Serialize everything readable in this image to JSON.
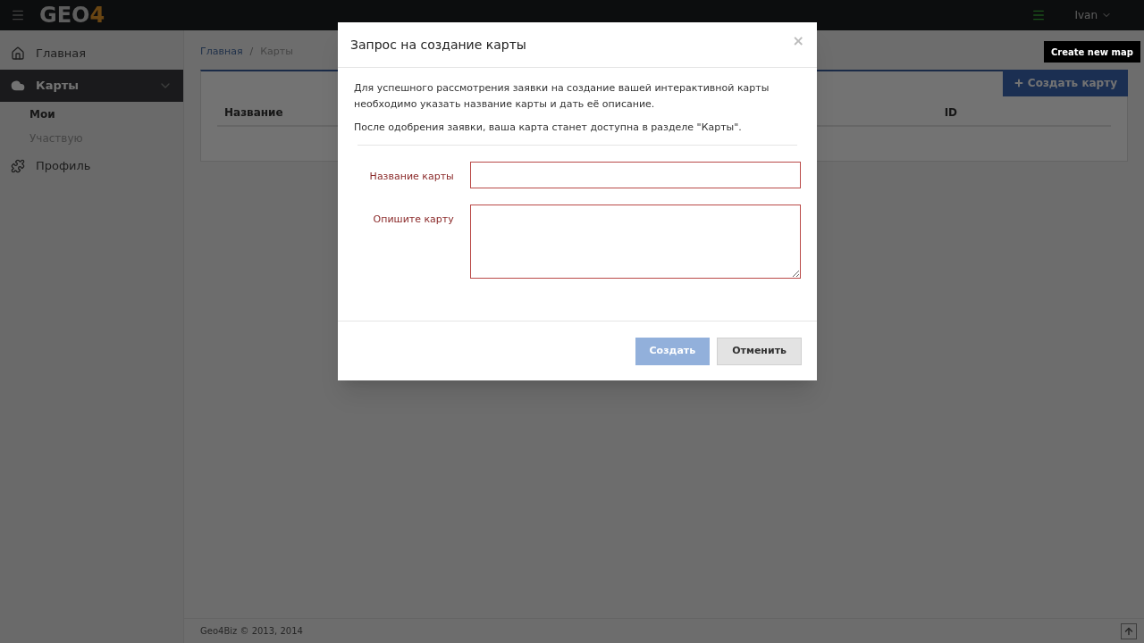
{
  "topbar": {
    "logo_main": "GEO",
    "logo_accent": "4",
    "user": "Ivan"
  },
  "sidebar": {
    "items": [
      {
        "label": "Главная",
        "selected": false,
        "expanded": false
      },
      {
        "label": "Карты",
        "selected": true,
        "expanded": true,
        "children": [
          {
            "label": "Мои",
            "selected": true
          },
          {
            "label": "Участвую",
            "selected": false
          }
        ]
      },
      {
        "label": "Профиль",
        "selected": false,
        "expanded": false
      }
    ]
  },
  "breadcrumb": [
    "Главная",
    "/",
    "Карты"
  ],
  "create_button": "Создать карту",
  "tooltip": "Create new map",
  "table": {
    "columns": [
      "Название",
      "ID"
    ]
  },
  "footer": "Geo4Biz © 2013, 2014",
  "modal": {
    "title": "Запрос на создание карты",
    "close": "×",
    "paragraphs": [
      "Для успешного рассмотрения заявки на создание вашей интерактивной карты необходимо указать название карты и дать её описание.",
      "После одобрения заявки, ваша карта станет доступна в разделе \"Карты\"."
    ],
    "fields": [
      {
        "label": "Название карты",
        "kind": "input"
      },
      {
        "label": "Опишите карту",
        "kind": "textarea"
      }
    ],
    "buttons": [
      {
        "label": "Создать",
        "kind": "primary",
        "disabled": true
      },
      {
        "label": "Отменить",
        "kind": "default",
        "disabled": false
      }
    ]
  }
}
